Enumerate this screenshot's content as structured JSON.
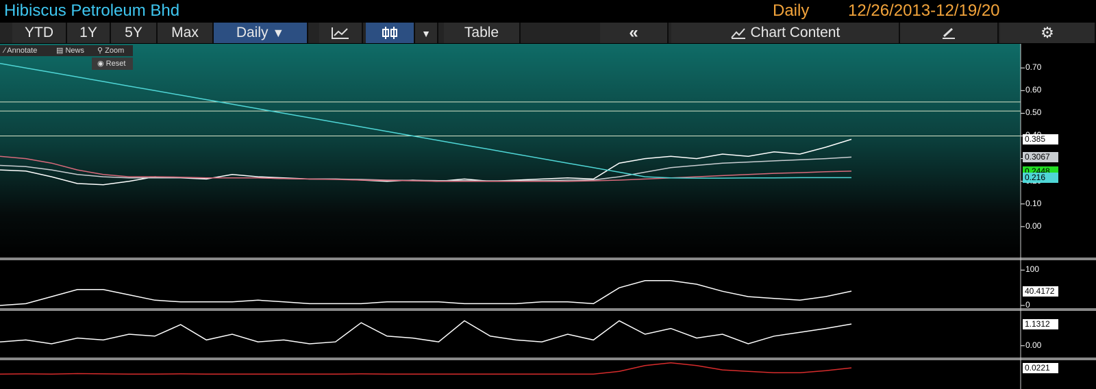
{
  "header": {
    "title": "Hibiscus Petroleum Bhd",
    "frequency": "Daily",
    "date_range": "12/26/2013-12/19/20"
  },
  "toolbar": {
    "ytd": "YTD",
    "y1": "1Y",
    "y5": "5Y",
    "max": "Max",
    "daily": "Daily",
    "table": "Table",
    "chart_content": "Chart Content"
  },
  "mini_toolbar": {
    "annotate": "Annotate",
    "news": "News",
    "zoom": "Zoom",
    "reset": "Reset"
  },
  "chart_data": [
    {
      "type": "line",
      "panel": "price",
      "yticks": [
        "0.70",
        "0.60",
        "0.50",
        "0.40",
        "0.30",
        "0.20",
        "0.10",
        "0.00"
      ],
      "ylim": [
        -0.1,
        0.77
      ],
      "series": [
        {
          "values": [
            0.25,
            0.245,
            0.22,
            0.19,
            0.185,
            0.2,
            0.22,
            0.215,
            0.21,
            0.23,
            0.22,
            0.215,
            0.21,
            0.21,
            0.205,
            0.2,
            0.205,
            0.2,
            0.21,
            0.2,
            0.205,
            0.21,
            0.215,
            0.21,
            0.28,
            0.3,
            0.31,
            0.3,
            0.32,
            0.31,
            0.33,
            0.32,
            0.35,
            0.385
          ],
          "color": "#ffffff"
        },
        {
          "values": [
            0.27,
            0.265,
            0.25,
            0.23,
            0.22,
            0.215,
            0.215,
            0.215,
            0.215,
            0.215,
            0.215,
            0.212,
            0.21,
            0.21,
            0.208,
            0.205,
            0.204,
            0.203,
            0.203,
            0.202,
            0.202,
            0.203,
            0.205,
            0.206,
            0.22,
            0.24,
            0.26,
            0.27,
            0.28,
            0.285,
            0.29,
            0.295,
            0.3,
            0.3067
          ],
          "color": "#c9cdd1"
        },
        {
          "values": [
            0.31,
            0.3,
            0.28,
            0.25,
            0.23,
            0.22,
            0.22,
            0.218,
            0.215,
            0.215,
            0.215,
            0.212,
            0.21,
            0.208,
            0.205,
            0.204,
            0.202,
            0.2,
            0.2,
            0.2,
            0.2,
            0.2,
            0.2,
            0.202,
            0.205,
            0.21,
            0.215,
            0.22,
            0.225,
            0.23,
            0.235,
            0.238,
            0.242,
            0.2448
          ],
          "color": "#d96a7b"
        },
        {
          "values": [
            0.72,
            0.7,
            0.68,
            0.66,
            0.64,
            0.62,
            0.6,
            0.58,
            0.56,
            0.54,
            0.52,
            0.5,
            0.48,
            0.46,
            0.44,
            0.42,
            0.4,
            0.38,
            0.36,
            0.34,
            0.32,
            0.3,
            0.28,
            0.26,
            0.24,
            0.22,
            0.215,
            0.214,
            0.214,
            0.215,
            0.215,
            0.216,
            0.216,
            0.216
          ],
          "color": "#4fd6d6"
        }
      ],
      "hlines": [
        0.55,
        0.51,
        0.4
      ],
      "value_labels": [
        "0.385",
        "0.3067",
        "0.2448",
        "0.216"
      ]
    },
    {
      "type": "line",
      "panel": "indicator-1",
      "yticks": [
        "100",
        "0"
      ],
      "ylim": [
        0,
        120
      ],
      "series": [
        {
          "values": [
            0,
            5,
            25,
            45,
            45,
            30,
            15,
            10,
            10,
            10,
            15,
            10,
            5,
            5,
            5,
            10,
            10,
            10,
            5,
            5,
            5,
            10,
            10,
            5,
            50,
            70,
            70,
            60,
            40,
            25,
            20,
            15,
            25,
            40.4172
          ],
          "color": "#ffffff"
        }
      ],
      "value_labels": [
        "40.4172"
      ]
    },
    {
      "type": "line",
      "panel": "indicator-2",
      "yticks": [
        "0.00"
      ],
      "ylim": [
        -0.4,
        1.6
      ],
      "series": [
        {
          "values": [
            0.2,
            0.3,
            0.1,
            0.4,
            0.3,
            0.6,
            0.5,
            1.1,
            0.3,
            0.6,
            0.2,
            0.3,
            0.1,
            0.2,
            1.2,
            0.5,
            0.4,
            0.2,
            1.3,
            0.5,
            0.3,
            0.2,
            0.6,
            0.3,
            1.3,
            0.6,
            0.9,
            0.4,
            0.6,
            0.1,
            0.5,
            0.7,
            0.9,
            1.1312
          ],
          "color": "#ffffff"
        }
      ],
      "value_labels": [
        "1.1312"
      ]
    },
    {
      "type": "line",
      "panel": "indicator-3",
      "series": [
        {
          "values": [
            0.0,
            0.001,
            0.0,
            0.002,
            0.001,
            0.0,
            0.0,
            0.001,
            0.0,
            0.0,
            0.0,
            0.0,
            0.0,
            0.0,
            0.001,
            0.0,
            0.0,
            0.0,
            0.0,
            0.0,
            0.0,
            0.0,
            0.0,
            0.0,
            0.01,
            0.03,
            0.04,
            0.03,
            0.015,
            0.01,
            0.005,
            0.005,
            0.012,
            0.0221
          ],
          "color": "#d82c2c"
        }
      ],
      "value_labels": [
        "0.0221"
      ]
    }
  ]
}
